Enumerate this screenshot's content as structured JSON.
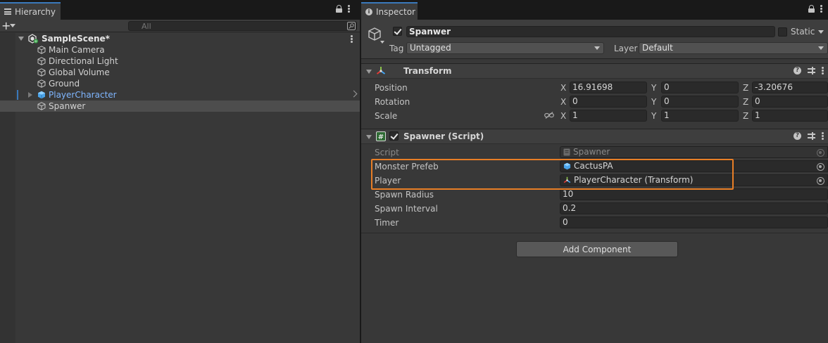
{
  "hierarchy": {
    "tab_label": "Hierarchy",
    "add_label": "+",
    "search_placeholder": "All",
    "items": [
      {
        "label": "SampleScene*",
        "type": "scene"
      },
      {
        "label": "Main Camera",
        "type": "object"
      },
      {
        "label": "Directional Light",
        "type": "object"
      },
      {
        "label": "Global Volume",
        "type": "object"
      },
      {
        "label": "Ground",
        "type": "object"
      },
      {
        "label": "PlayerCharacter",
        "type": "prefab"
      },
      {
        "label": "Spanwer",
        "type": "object",
        "selected": true
      }
    ]
  },
  "inspector": {
    "tab_label": "Inspector",
    "object_name": "Spanwer",
    "static_label": "Static",
    "tag_label": "Tag",
    "tag_value": "Untagged",
    "layer_label": "Layer",
    "layer_value": "Default",
    "transform": {
      "title": "Transform",
      "position": {
        "label": "Position",
        "x": "16.91698",
        "y": "0",
        "z": "-3.20676"
      },
      "rotation": {
        "label": "Rotation",
        "x": "0",
        "y": "0",
        "z": "0"
      },
      "scale": {
        "label": "Scale",
        "x": "1",
        "y": "1",
        "z": "1"
      },
      "axis_x": "X",
      "axis_y": "Y",
      "axis_z": "Z"
    },
    "spawner": {
      "title": "Spawner (Script)",
      "script_label": "Script",
      "script_value": "Spawner",
      "monster_label": "Monster Prefeb",
      "monster_value": "CactusPA",
      "player_label": "Player",
      "player_value": "PlayerCharacter (Transform)",
      "radius_label": "Spawn Radius",
      "radius_value": "10",
      "interval_label": "Spawn Interval",
      "interval_value": "0.2",
      "timer_label": "Timer",
      "timer_value": "0"
    },
    "add_component_label": "Add Component"
  },
  "colors": {
    "highlight": "#e87e26",
    "prefab_text": "#7fb6ff",
    "tab_accent": "#3a79bb"
  }
}
